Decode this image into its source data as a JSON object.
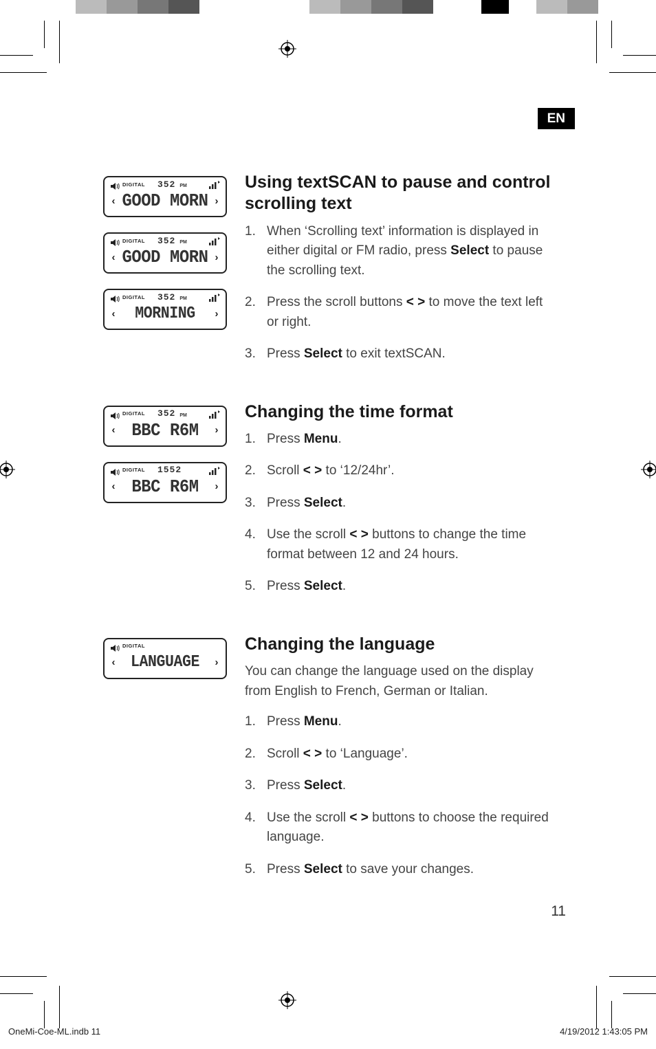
{
  "lang_tab": "EN",
  "page_number": "11",
  "footer": {
    "file": "OneMi-Coe-ML.indb   11",
    "datetime": "4/19/2012   1:43:05 PM"
  },
  "lcd_panels": [
    {
      "digital": "DIGITAL",
      "time": "352",
      "pm": "PM",
      "text": "GOOD MORN",
      "left": "‹",
      "right": "›",
      "show_time": true,
      "show_sig": true
    },
    {
      "digital": "DIGITAL",
      "time": "352",
      "pm": "PM",
      "text": "GOOD MORN",
      "left": "‹",
      "right": "›",
      "show_time": true,
      "show_sig": true
    },
    {
      "digital": "DIGITAL",
      "time": "352",
      "pm": "PM",
      "text": "MORNING",
      "left": "‹",
      "right": "›",
      "show_time": true,
      "show_sig": true
    },
    {
      "digital": "DIGITAL",
      "time": "352",
      "pm": "PM",
      "text": "BBC R6M",
      "left": "‹",
      "right": "›",
      "show_time": true,
      "show_sig": true
    },
    {
      "digital": "DIGITAL",
      "time": "1552",
      "pm": "",
      "text": "BBC R6M",
      "left": "‹",
      "right": "›",
      "show_time": true,
      "show_sig": true
    },
    {
      "digital": "DIGITAL",
      "time": "",
      "pm": "",
      "text": "LANGUAGE",
      "left": "‹",
      "right": "›",
      "show_time": false,
      "show_sig": false
    }
  ],
  "sections": [
    {
      "heading": "Using textSCAN to pause and control scrolling text",
      "intro": "",
      "items": [
        {
          "pre": "When ‘Scrolling text’ information is displayed in either digital or FM radio, press ",
          "bold1": "Select",
          "mid": " to pause the scrolling text.",
          "bold2": "",
          "post": ""
        },
        {
          "pre": "Press the scroll buttons ",
          "bold1": "< >",
          "mid": " to move the text left or right.",
          "bold2": "",
          "post": ""
        },
        {
          "pre": "Press ",
          "bold1": "Select",
          "mid": " to exit textSCAN.",
          "bold2": "",
          "post": ""
        }
      ]
    },
    {
      "heading": "Changing the time format",
      "intro": "",
      "items": [
        {
          "pre": "Press ",
          "bold1": "Menu",
          "mid": ".",
          "bold2": "",
          "post": ""
        },
        {
          "pre": "Scroll ",
          "bold1": "< >",
          "mid": " to ‘12/24hr’.",
          "bold2": "",
          "post": ""
        },
        {
          "pre": "Press ",
          "bold1": "Select",
          "mid": ".",
          "bold2": "",
          "post": ""
        },
        {
          "pre": "Use the scroll ",
          "bold1": "< >",
          "mid": " buttons to change the time format between 12 and 24 hours.",
          "bold2": "",
          "post": ""
        },
        {
          "pre": "Press ",
          "bold1": "Select",
          "mid": ".",
          "bold2": "",
          "post": ""
        }
      ]
    },
    {
      "heading": "Changing the language",
      "intro": "You can change the language used on the display from English to French, German or Italian.",
      "items": [
        {
          "pre": "Press ",
          "bold1": "Menu",
          "mid": ".",
          "bold2": "",
          "post": ""
        },
        {
          "pre": "Scroll ",
          "bold1": "< >",
          "mid": " to ‘Language’.",
          "bold2": "",
          "post": ""
        },
        {
          "pre": "Press ",
          "bold1": "Select",
          "mid": ".",
          "bold2": "",
          "post": ""
        },
        {
          "pre": "Use the scroll ",
          "bold1": "< >",
          "mid": " buttons to choose the required language.",
          "bold2": "",
          "post": ""
        },
        {
          "pre": "Press ",
          "bold1": "Select",
          "mid": " to save your changes.",
          "bold2": "",
          "post": ""
        }
      ]
    }
  ]
}
